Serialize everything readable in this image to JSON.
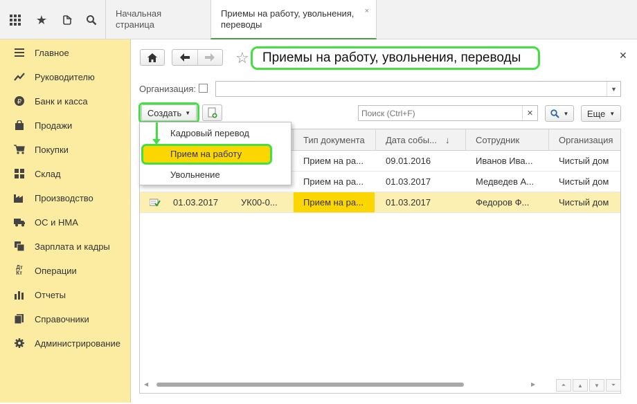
{
  "tabs": {
    "home": "Начальная страница",
    "current": "Приемы на работу, увольнения, переводы",
    "close": "×"
  },
  "sidebar": {
    "items": [
      {
        "label": "Главное",
        "icon": "menu-lines-icon"
      },
      {
        "label": "Руководителю",
        "icon": "trend-icon"
      },
      {
        "label": "Банк и касса",
        "icon": "ruble-icon"
      },
      {
        "label": "Продажи",
        "icon": "bag-icon"
      },
      {
        "label": "Покупки",
        "icon": "cart-icon"
      },
      {
        "label": "Склад",
        "icon": "warehouse-icon"
      },
      {
        "label": "Производство",
        "icon": "factory-icon"
      },
      {
        "label": "ОС и НМА",
        "icon": "truck-icon"
      },
      {
        "label": "Зарплата и кадры",
        "icon": "people-icon"
      },
      {
        "label": "Операции",
        "icon": "dt-kt-icon"
      },
      {
        "label": "Отчеты",
        "icon": "bar-chart-icon"
      },
      {
        "label": "Справочники",
        "icon": "book-icon"
      },
      {
        "label": "Администрирование",
        "icon": "gear-icon"
      }
    ]
  },
  "page": {
    "title": "Приемы на работу, увольнения, переводы",
    "org_label": "Организация:",
    "create_label": "Создать",
    "search_placeholder": "Поиск (Ctrl+F)",
    "more_label": "Еще"
  },
  "dropdown": {
    "items": [
      "Кадровый перевод",
      "Прием на работу",
      "Увольнение"
    ]
  },
  "table": {
    "columns": [
      "Тип документа",
      "Дата собы...",
      "Сотрудник",
      "Организация"
    ],
    "rows": [
      {
        "date": "",
        "number": "",
        "type": "Прием на ра...",
        "event_date": "09.01.2016",
        "employee": "Иванов Ива...",
        "org": "Чистый дом"
      },
      {
        "date": "",
        "number": "",
        "type": "Прием на ра...",
        "event_date": "01.03.2017",
        "employee": "Медведев А...",
        "org": "Чистый дом"
      },
      {
        "date": "01.03.2017",
        "number": "УК00-0...",
        "type": "Прием на ра...",
        "event_date": "01.03.2017",
        "employee": "Федоров Ф...",
        "org": "Чистый дом"
      }
    ]
  },
  "colors": {
    "sidebar_bg": "#fbeca2",
    "highlight_green": "#42e042",
    "selected_yellow": "#fcd600"
  }
}
